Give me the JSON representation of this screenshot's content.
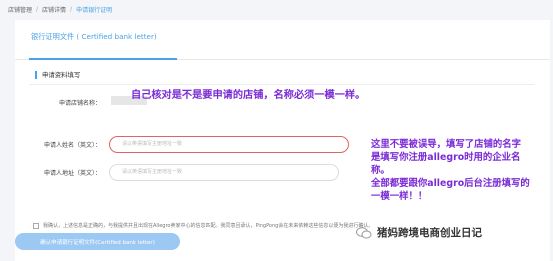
{
  "breadcrumb": {
    "items": [
      "店铺管理",
      "店铺详情",
      "申请银行证明"
    ]
  },
  "tab": {
    "label": "银行证明文件 ( Certified bank letter)"
  },
  "section": {
    "title": "申请资料填写"
  },
  "fields": {
    "store_name_label": "申请店铺名称：",
    "applicant_name_label": "申请人姓名（英文）：",
    "applicant_name_placeholder": "请以英语填写主册地址一致",
    "applicant_address_label": "申请人地址（英文）：",
    "applicant_address_placeholder": "请以英语填写主册地址一致"
  },
  "annotations": {
    "note1": "自己核对是不是要申请的店铺，名称必须一模一样。",
    "note2_lines": [
      "这里不要被误导，填写了店铺的名字",
      "是填写你注册allegro时用的企业名",
      "称。",
      "全部都要跟你allegro后台注册填写的",
      "一模一样！！"
    ]
  },
  "agreement": {
    "text": "我确认，上述信息是正确的，与我提供并且出现在Allegro卖家中心的信息匹配。我同意且承认，PingPong会在未来依赖这些信息以便为我进行确认。"
  },
  "submit": {
    "label": "确认申请银行证明文件(Certified bank letter)"
  },
  "watermark": {
    "text": "猪妈跨境电商创业日记"
  },
  "colors": {
    "accent": "#4aa3e8",
    "annotation": "#7a2bd6",
    "highlight_border": "#e06464",
    "button": "#9cc9f3"
  }
}
